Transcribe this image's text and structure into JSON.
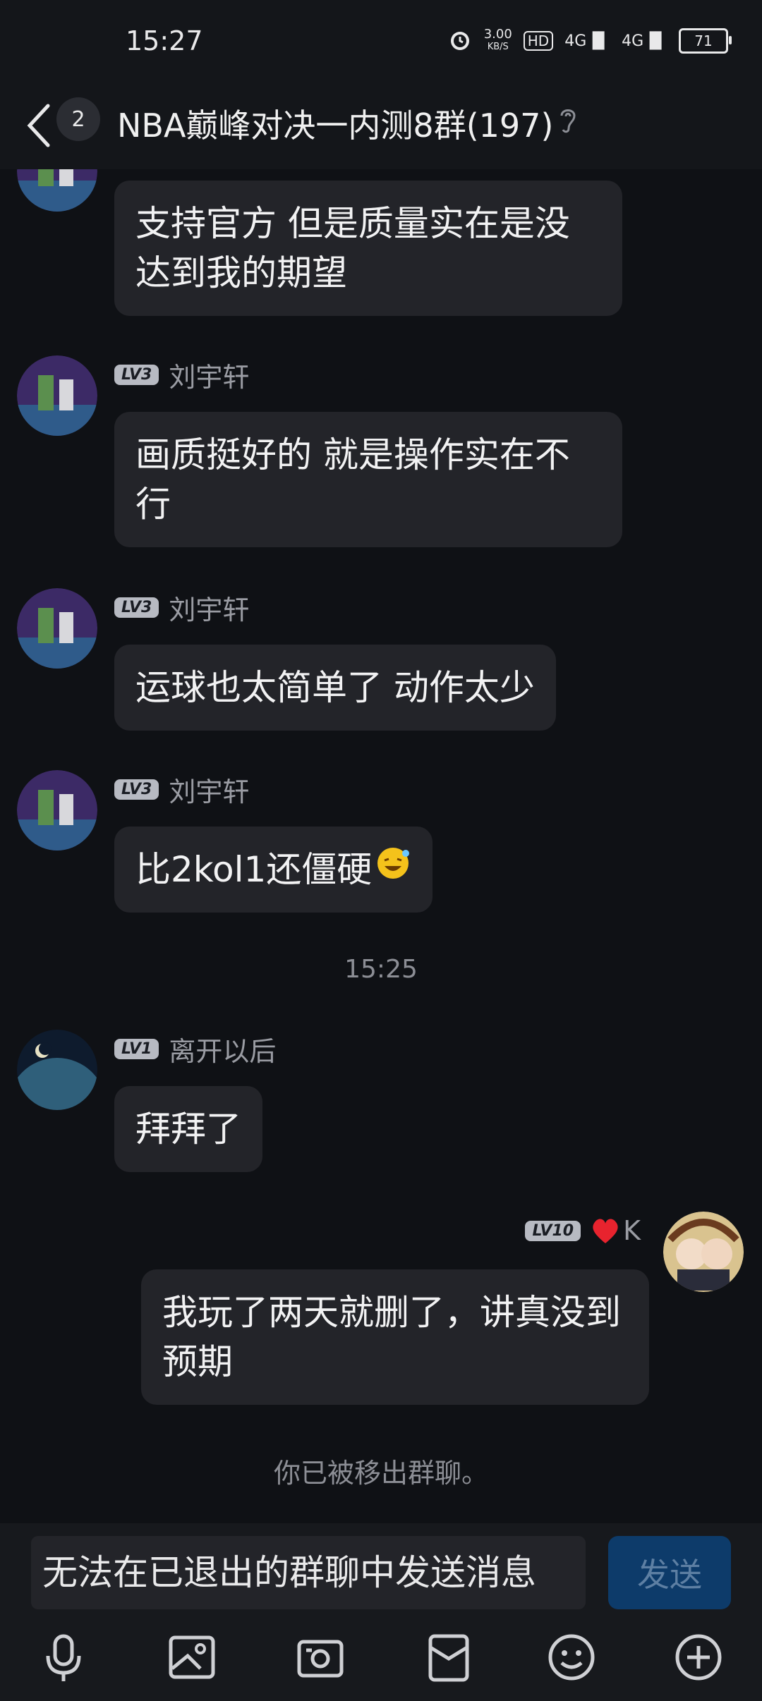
{
  "status_bar": {
    "time": "15:27",
    "net_speed": "3.00",
    "net_unit": "KB/S",
    "hd": "HD",
    "signal1": "4G",
    "signal2": "4G",
    "battery": "71"
  },
  "header": {
    "unread_count": "2",
    "title": "NBA巅峰对决一内测8群(197)"
  },
  "messages": [
    {
      "text": "支持官方 但是质量实在是没达到我的期望"
    },
    {
      "level": "LV3",
      "name": "刘宇轩",
      "text": "画质挺好的 就是操作实在不行"
    },
    {
      "level": "LV3",
      "name": "刘宇轩",
      "text": "运球也太简单了 动作太少"
    },
    {
      "level": "LV3",
      "name": "刘宇轩",
      "text": "比2kol1还僵硬"
    },
    {
      "level": "LV1",
      "name": "离开以后",
      "text": "拜拜了"
    },
    {
      "level": "LV10",
      "name": "K",
      "text": "我玩了两天就删了，讲真没到预期"
    }
  ],
  "timestamp": "15:25",
  "notice": "你已被移出群聊。",
  "input": {
    "placeholder": "无法在已退出的群聊中发送消息",
    "send_label": "发送"
  },
  "toolbar_icons": [
    "microphone-icon",
    "image-icon",
    "camera-icon",
    "red-packet-icon",
    "emoji-icon",
    "plus-icon"
  ]
}
